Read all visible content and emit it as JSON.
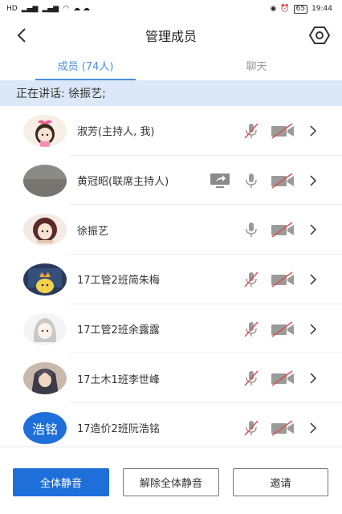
{
  "status_bar": {
    "left_items": [
      "HD",
      "4G",
      "4G",
      "WiFi"
    ],
    "right_items": [
      "N",
      "eye",
      "alarm"
    ],
    "battery": "65",
    "time": "19:44"
  },
  "header": {
    "title": "管理成员",
    "back_icon": "chevron-left-icon",
    "settings_icon": "gear-icon"
  },
  "tabs": [
    {
      "label": "成员 (74人)",
      "active": true
    },
    {
      "label": "聊天",
      "active": false
    }
  ],
  "speaking_banner": "正在讲话: 徐振艺;",
  "members": [
    {
      "name": "淑芳(主持人, 我)",
      "avatar": "cartoon-girl-pink-bow",
      "mic": "muted",
      "camera": "off",
      "screen_share": false
    },
    {
      "name": "黄冠昭(联席主持人)",
      "avatar": "gray-photo",
      "mic": "on",
      "camera": "off",
      "screen_share": true
    },
    {
      "name": "徐振艺",
      "avatar": "cartoon-girl-dark-hair",
      "mic": "on",
      "camera": "off",
      "screen_share": false
    },
    {
      "name": "17工管2班简朱梅",
      "avatar": "cartoon-character-crown",
      "mic": "muted",
      "camera": "off",
      "screen_share": false
    },
    {
      "name": "17工管2班余露露",
      "avatar": "anime-girl-sketch",
      "mic": "muted",
      "camera": "off",
      "screen_share": false
    },
    {
      "name": "17土木1班李世峰",
      "avatar": "anime-character-dark",
      "mic": "muted",
      "camera": "off",
      "screen_share": false
    },
    {
      "name": "17造价2班阮浩铭",
      "avatar": "text-avatar",
      "avatar_text": "浩铭",
      "mic": "muted",
      "camera": "off",
      "screen_share": false
    }
  ],
  "actions": {
    "mute_all": "全体静音",
    "unmute_all": "解除全体静音",
    "invite": "邀请"
  },
  "colors": {
    "accent": "#1e6fd9",
    "tab_active": "#4a90e2",
    "banner_bg": "#dbe8f7",
    "muted_red": "#d9534f"
  }
}
